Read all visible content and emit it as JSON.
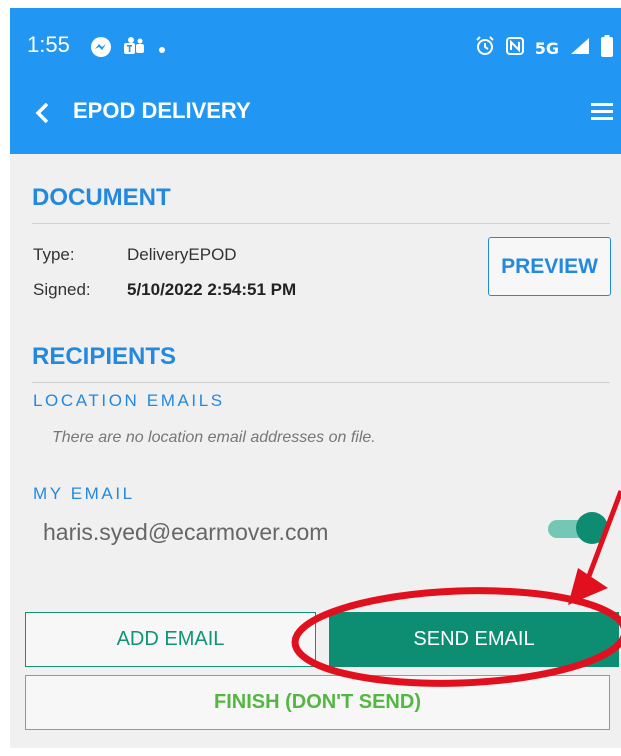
{
  "status_bar": {
    "time": "1:55",
    "network": "5G"
  },
  "header": {
    "title": "EPOD DELIVERY"
  },
  "document": {
    "heading": "DOCUMENT",
    "type_label": "Type:",
    "type_value": "DeliveryEPOD",
    "signed_label": "Signed:",
    "signed_value": "5/10/2022 2:54:51 PM",
    "preview_label": "PREVIEW"
  },
  "recipients": {
    "heading": "RECIPIENTS",
    "location_emails_label": "LOCATION EMAILS",
    "location_emails_empty": "There are no location email addresses on file.",
    "my_email_label": "MY EMAIL",
    "my_email": "haris.syed@ecarmover.com"
  },
  "actions": {
    "add_email": "ADD EMAIL",
    "send_email": "SEND EMAIL",
    "finish": "FINISH (DON'T SEND)"
  },
  "colors": {
    "header": "#2196f3",
    "accent_blue": "#2389e0",
    "accent_green": "#0d8e73",
    "finish_green": "#55b743",
    "annotation_red": "#e0101e"
  }
}
